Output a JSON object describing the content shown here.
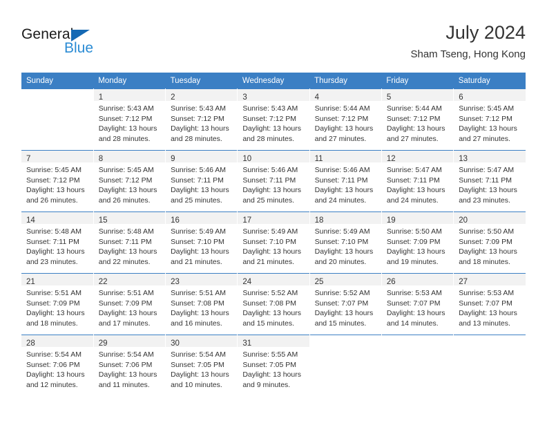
{
  "brand": {
    "name_part1": "General",
    "name_part2": "Blue",
    "triangle_color": "#1569b4",
    "blue_color": "#2a8bd4"
  },
  "header": {
    "month_title": "July 2024",
    "location": "Sham Tseng, Hong Kong"
  },
  "theme": {
    "header_bg": "#3b7fc4",
    "header_text": "#ffffff",
    "daynum_band_bg": "#f2f2f2",
    "cell_bg": "#ffffff",
    "text": "#333333",
    "row_rule": "#3b7fc4"
  },
  "weekday_headers": [
    "Sunday",
    "Monday",
    "Tuesday",
    "Wednesday",
    "Thursday",
    "Friday",
    "Saturday"
  ],
  "weeks": [
    [
      {
        "day": "",
        "lines": []
      },
      {
        "day": "1",
        "lines": [
          "Sunrise: 5:43 AM",
          "Sunset: 7:12 PM",
          "Daylight: 13 hours",
          "and 28 minutes."
        ]
      },
      {
        "day": "2",
        "lines": [
          "Sunrise: 5:43 AM",
          "Sunset: 7:12 PM",
          "Daylight: 13 hours",
          "and 28 minutes."
        ]
      },
      {
        "day": "3",
        "lines": [
          "Sunrise: 5:43 AM",
          "Sunset: 7:12 PM",
          "Daylight: 13 hours",
          "and 28 minutes."
        ]
      },
      {
        "day": "4",
        "lines": [
          "Sunrise: 5:44 AM",
          "Sunset: 7:12 PM",
          "Daylight: 13 hours",
          "and 27 minutes."
        ]
      },
      {
        "day": "5",
        "lines": [
          "Sunrise: 5:44 AM",
          "Sunset: 7:12 PM",
          "Daylight: 13 hours",
          "and 27 minutes."
        ]
      },
      {
        "day": "6",
        "lines": [
          "Sunrise: 5:45 AM",
          "Sunset: 7:12 PM",
          "Daylight: 13 hours",
          "and 27 minutes."
        ]
      }
    ],
    [
      {
        "day": "7",
        "lines": [
          "Sunrise: 5:45 AM",
          "Sunset: 7:12 PM",
          "Daylight: 13 hours",
          "and 26 minutes."
        ]
      },
      {
        "day": "8",
        "lines": [
          "Sunrise: 5:45 AM",
          "Sunset: 7:12 PM",
          "Daylight: 13 hours",
          "and 26 minutes."
        ]
      },
      {
        "day": "9",
        "lines": [
          "Sunrise: 5:46 AM",
          "Sunset: 7:11 PM",
          "Daylight: 13 hours",
          "and 25 minutes."
        ]
      },
      {
        "day": "10",
        "lines": [
          "Sunrise: 5:46 AM",
          "Sunset: 7:11 PM",
          "Daylight: 13 hours",
          "and 25 minutes."
        ]
      },
      {
        "day": "11",
        "lines": [
          "Sunrise: 5:46 AM",
          "Sunset: 7:11 PM",
          "Daylight: 13 hours",
          "and 24 minutes."
        ]
      },
      {
        "day": "12",
        "lines": [
          "Sunrise: 5:47 AM",
          "Sunset: 7:11 PM",
          "Daylight: 13 hours",
          "and 24 minutes."
        ]
      },
      {
        "day": "13",
        "lines": [
          "Sunrise: 5:47 AM",
          "Sunset: 7:11 PM",
          "Daylight: 13 hours",
          "and 23 minutes."
        ]
      }
    ],
    [
      {
        "day": "14",
        "lines": [
          "Sunrise: 5:48 AM",
          "Sunset: 7:11 PM",
          "Daylight: 13 hours",
          "and 23 minutes."
        ]
      },
      {
        "day": "15",
        "lines": [
          "Sunrise: 5:48 AM",
          "Sunset: 7:11 PM",
          "Daylight: 13 hours",
          "and 22 minutes."
        ]
      },
      {
        "day": "16",
        "lines": [
          "Sunrise: 5:49 AM",
          "Sunset: 7:10 PM",
          "Daylight: 13 hours",
          "and 21 minutes."
        ]
      },
      {
        "day": "17",
        "lines": [
          "Sunrise: 5:49 AM",
          "Sunset: 7:10 PM",
          "Daylight: 13 hours",
          "and 21 minutes."
        ]
      },
      {
        "day": "18",
        "lines": [
          "Sunrise: 5:49 AM",
          "Sunset: 7:10 PM",
          "Daylight: 13 hours",
          "and 20 minutes."
        ]
      },
      {
        "day": "19",
        "lines": [
          "Sunrise: 5:50 AM",
          "Sunset: 7:09 PM",
          "Daylight: 13 hours",
          "and 19 minutes."
        ]
      },
      {
        "day": "20",
        "lines": [
          "Sunrise: 5:50 AM",
          "Sunset: 7:09 PM",
          "Daylight: 13 hours",
          "and 18 minutes."
        ]
      }
    ],
    [
      {
        "day": "21",
        "lines": [
          "Sunrise: 5:51 AM",
          "Sunset: 7:09 PM",
          "Daylight: 13 hours",
          "and 18 minutes."
        ]
      },
      {
        "day": "22",
        "lines": [
          "Sunrise: 5:51 AM",
          "Sunset: 7:09 PM",
          "Daylight: 13 hours",
          "and 17 minutes."
        ]
      },
      {
        "day": "23",
        "lines": [
          "Sunrise: 5:51 AM",
          "Sunset: 7:08 PM",
          "Daylight: 13 hours",
          "and 16 minutes."
        ]
      },
      {
        "day": "24",
        "lines": [
          "Sunrise: 5:52 AM",
          "Sunset: 7:08 PM",
          "Daylight: 13 hours",
          "and 15 minutes."
        ]
      },
      {
        "day": "25",
        "lines": [
          "Sunrise: 5:52 AM",
          "Sunset: 7:07 PM",
          "Daylight: 13 hours",
          "and 15 minutes."
        ]
      },
      {
        "day": "26",
        "lines": [
          "Sunrise: 5:53 AM",
          "Sunset: 7:07 PM",
          "Daylight: 13 hours",
          "and 14 minutes."
        ]
      },
      {
        "day": "27",
        "lines": [
          "Sunrise: 5:53 AM",
          "Sunset: 7:07 PM",
          "Daylight: 13 hours",
          "and 13 minutes."
        ]
      }
    ],
    [
      {
        "day": "28",
        "lines": [
          "Sunrise: 5:54 AM",
          "Sunset: 7:06 PM",
          "Daylight: 13 hours",
          "and 12 minutes."
        ]
      },
      {
        "day": "29",
        "lines": [
          "Sunrise: 5:54 AM",
          "Sunset: 7:06 PM",
          "Daylight: 13 hours",
          "and 11 minutes."
        ]
      },
      {
        "day": "30",
        "lines": [
          "Sunrise: 5:54 AM",
          "Sunset: 7:05 PM",
          "Daylight: 13 hours",
          "and 10 minutes."
        ]
      },
      {
        "day": "31",
        "lines": [
          "Sunrise: 5:55 AM",
          "Sunset: 7:05 PM",
          "Daylight: 13 hours",
          "and 9 minutes."
        ]
      },
      {
        "day": "",
        "lines": []
      },
      {
        "day": "",
        "lines": []
      },
      {
        "day": "",
        "lines": []
      }
    ]
  ]
}
